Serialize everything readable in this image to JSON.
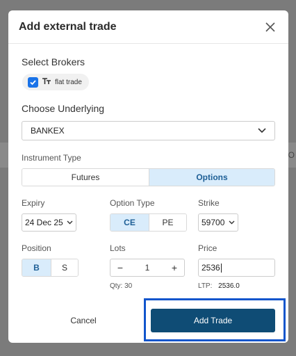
{
  "background": {
    "peek_text": "O"
  },
  "modal": {
    "title": "Add external trade",
    "close_icon": "close-icon"
  },
  "brokers": {
    "label": "Select Brokers",
    "items": [
      {
        "name": "flat trade",
        "logo": "T",
        "checked": true
      }
    ]
  },
  "underlying": {
    "label": "Choose Underlying",
    "value": "BANKEX"
  },
  "instrument_type": {
    "label": "Instrument Type",
    "options": [
      "Futures",
      "Options"
    ],
    "selected": "Options"
  },
  "expiry": {
    "label": "Expiry",
    "value": "24 Dec 25"
  },
  "option_type": {
    "label": "Option Type",
    "options": [
      "CE",
      "PE"
    ],
    "selected": "CE"
  },
  "strike": {
    "label": "Strike",
    "value": "59700"
  },
  "position": {
    "label": "Position",
    "options": [
      "B",
      "S"
    ],
    "selected": "B"
  },
  "lots": {
    "label": "Lots",
    "value": "1",
    "minus": "−",
    "plus": "+",
    "qty_text": "Qty: 30"
  },
  "price": {
    "label": "Price",
    "value": "2536",
    "ltp_label": "LTP:",
    "ltp_value": "2536.0"
  },
  "actions": {
    "cancel": "Cancel",
    "submit": "Add Trade"
  },
  "colors": {
    "accent": "#0f4c75",
    "selected_segment": "#d9ecfb",
    "highlight": "#1155cc",
    "checkbox": "#1a73e8"
  }
}
